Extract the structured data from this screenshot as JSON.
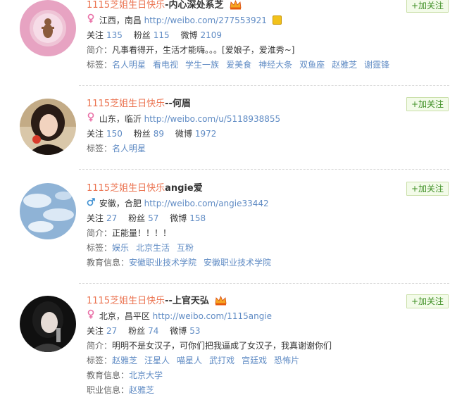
{
  "common": {
    "follow_label": "+加关注"
  },
  "labels": {
    "follow": "关注",
    "fans": "粉丝",
    "weibo": "微博",
    "intro": "简介：",
    "tags": "标签：",
    "edu": "教育信息：",
    "job": "职业信息："
  },
  "users": [
    {
      "name_prefix": "1115芝姐生日快乐",
      "name_suffix": "-内心深处系芝",
      "gender": "female",
      "location": "江西，南昌",
      "url": "http://weibo.com/277553921",
      "follow": "135",
      "fans": "115",
      "weibo": "2109",
      "intro": "凡事看得开，生活才能嗨。。。[爱娘子，爱淮秀~]",
      "tags": [
        "名人明星",
        "看电视",
        "学生一族",
        "爱美食",
        "神经大条",
        "双鱼座",
        "赵雅芝",
        "谢霆锋"
      ]
    },
    {
      "name_prefix": "1115芝姐生日快乐",
      "name_suffix": "--何眉",
      "gender": "female",
      "location": "山东，临沂",
      "url": "http://weibo.com/u/5118938855",
      "follow": "150",
      "fans": "89",
      "weibo": "1972",
      "tags": [
        "名人明星"
      ]
    },
    {
      "name_prefix": "1115芝姐生日快乐",
      "name_suffix": "angie爱",
      "gender": "male",
      "location": "安徽，合肥",
      "url": "http://weibo.com/angie33442",
      "follow": "27",
      "fans": "57",
      "weibo": "158",
      "intro": "正能量！！！！",
      "tags": [
        "娱乐",
        "北京生活",
        "互粉"
      ],
      "edu": [
        "安徽职业技术学院",
        "安徽职业技术学院"
      ]
    },
    {
      "name_prefix": "1115芝姐生日快乐",
      "name_suffix": "--上官天弘",
      "gender": "female",
      "location": "北京，昌平区",
      "url": "http://weibo.com/1115angie",
      "follow": "27",
      "fans": "74",
      "weibo": "53",
      "intro": "明明不是女汉子，可你们把我逼成了女汉子，我真谢谢你们",
      "tags": [
        "赵雅芝",
        "汪星人",
        "喵星人",
        "武打戏",
        "宫廷戏",
        "恐怖片"
      ],
      "edu": [
        "北京大学"
      ],
      "job": [
        "赵雅芝"
      ]
    }
  ]
}
